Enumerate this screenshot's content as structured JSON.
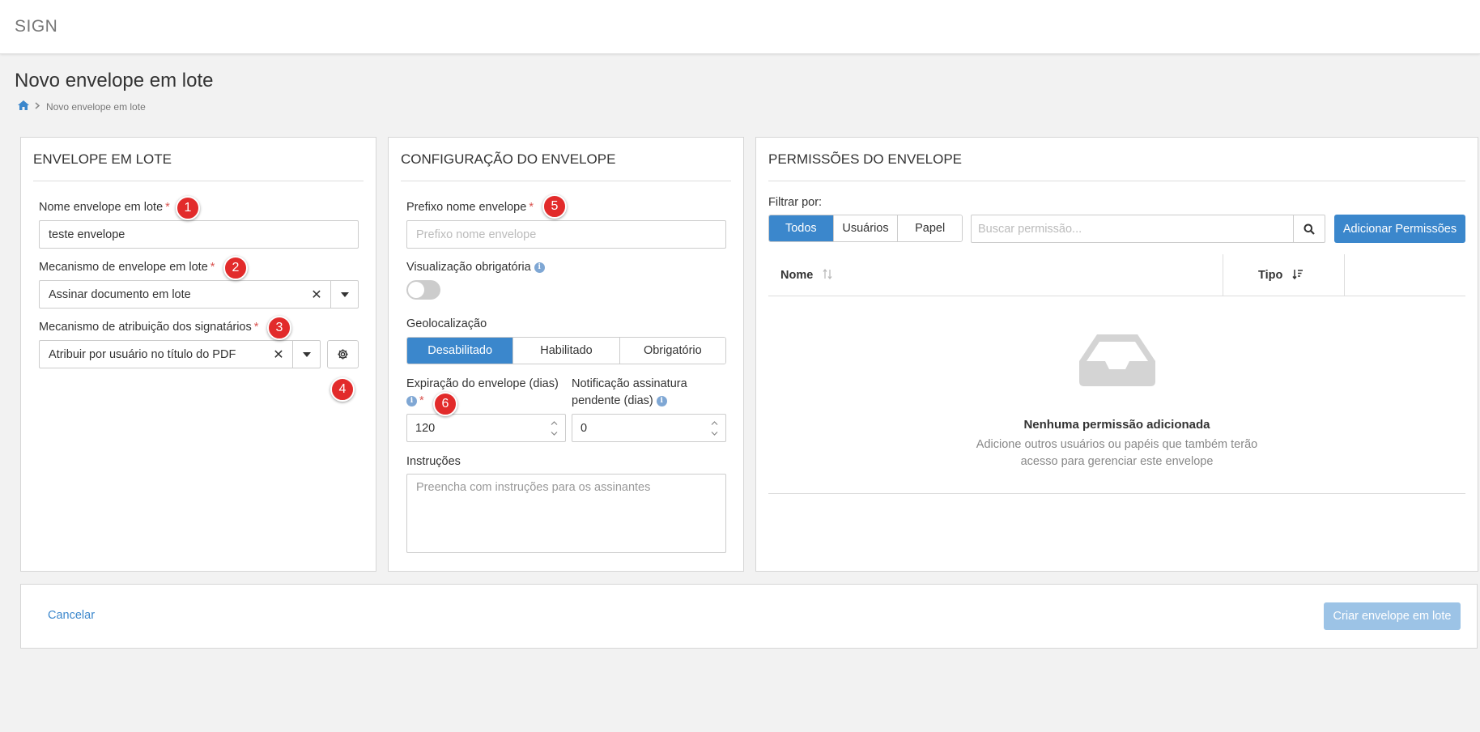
{
  "app": {
    "brand": "SIGN"
  },
  "page": {
    "title": "Novo envelope em lote"
  },
  "breadcrumb": {
    "current": "Novo envelope em lote"
  },
  "panel1": {
    "title": "ENVELOPE EM LOTE",
    "name_label": "Nome envelope em lote",
    "name_value": "teste envelope",
    "mechanism_label": "Mecanismo de envelope em lote",
    "mechanism_value": "Assinar documento em lote",
    "assign_label": "Mecanismo de atribuição dos signatários",
    "assign_value": "Atribuir por usuário no título do PDF"
  },
  "panel2": {
    "title": "CONFIGURAÇÃO DO ENVELOPE",
    "prefix_label": "Prefixo nome envelope",
    "prefix_placeholder": "Prefixo nome envelope",
    "mandatory_view_label": "Visualização obrigatória",
    "mandatory_view_on": false,
    "geo_label": "Geolocalização",
    "geo_options": [
      "Desabilitado",
      "Habilitado",
      "Obrigatório"
    ],
    "geo_selected": "Desabilitado",
    "expiration_label": "Expiração do envelope (dias)",
    "expiration_value": "120",
    "notification_label_1": "Notificação assinatura",
    "notification_label_2": "pendente (dias)",
    "notification_value": "0",
    "instructions_label": "Instruções",
    "instructions_placeholder": "Preencha com instruções para os assinantes"
  },
  "panel3": {
    "title": "PERMISSÕES DO ENVELOPE",
    "filter_label": "Filtrar por:",
    "filters": [
      "Todos",
      "Usuários",
      "Papel"
    ],
    "filter_selected": "Todos",
    "search_placeholder": "Buscar permissão...",
    "add_button": "Adicionar Permissões",
    "columns": [
      "Nome",
      "Tipo"
    ],
    "empty_title": "Nenhuma permissão adicionada",
    "empty_desc_1": "Adicione outros usuários ou papéis que também terão",
    "empty_desc_2": "acesso para gerenciar este envelope"
  },
  "footer": {
    "cancel": "Cancelar",
    "create": "Criar envelope em lote"
  },
  "badges": [
    "1",
    "2",
    "3",
    "4",
    "5",
    "6"
  ],
  "colors": {
    "primary": "#3b87cc",
    "required": "#d9534f",
    "badge": "#e22b2b",
    "disabled": "#9cc3e6"
  },
  "icons": [
    "home-icon",
    "chevron-right-icon",
    "times-icon",
    "caret-down-icon",
    "gear-icon",
    "info-icon",
    "spinner-arrows-icon",
    "search-icon",
    "sort-icon",
    "sort-desc-icon",
    "inbox-icon"
  ]
}
